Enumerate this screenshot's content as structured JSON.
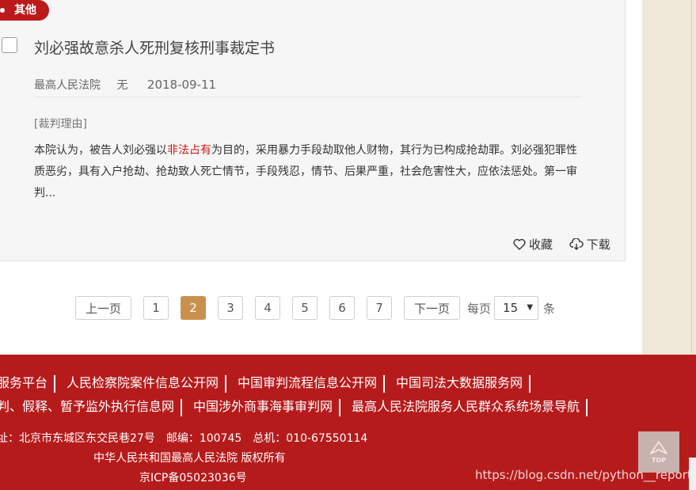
{
  "card": {
    "tag": "其他",
    "title": "刘必强故意杀人死刑复核刑事裁定书",
    "meta": {
      "court": "最高人民法院",
      "case_no": "无",
      "date": "2018-09-11"
    },
    "reason_label": "[裁判理由]",
    "reason_pre": "本院认为，被告人刘必强以",
    "reason_highlight": "非法占有",
    "reason_post": "为目的，采用暴力手段劫取他人财物，其行为已构成抢劫罪。刘必强犯罪性质恶劣，具有入户抢劫、抢劫致人死亡情节，手段残忍，情节、后果严重，社会危害性大，应依法惩处。第一审判...",
    "actions": {
      "favorite": "收藏",
      "download": "下载"
    }
  },
  "pagination": {
    "prev": "上一页",
    "pages": [
      "1",
      "2",
      "3",
      "4",
      "5",
      "6",
      "7"
    ],
    "current": "2",
    "next": "下一页",
    "per_page_label": "每页",
    "per_page_value": "15",
    "unit": "条"
  },
  "footer": {
    "links_row1": [
      "服务平台",
      "人民检察院案件信息公开网",
      "中国审判流程信息公开网",
      "中国司法大数据服务网"
    ],
    "links_row2": [
      "判、假释、暂予监外执行信息网",
      "中国涉外商事海事审判网",
      "最高人民法院服务人民群众系统场景导航"
    ],
    "address": "址：北京市东城区东交民巷27号",
    "postcode": "邮编：100745",
    "phone": "总机：010-67550114",
    "copyright": "中华人民共和国最高人民法院 版权所有",
    "icp": "京ICP备05023036号",
    "watermark": "https://blog.csdn.net/python__reported",
    "top_label": "TOP"
  },
  "colors": {
    "brand_red": "#b61b1c",
    "tag_red": "#bb1a1a",
    "active_page": "#c8924e",
    "highlight": "#d01515"
  }
}
